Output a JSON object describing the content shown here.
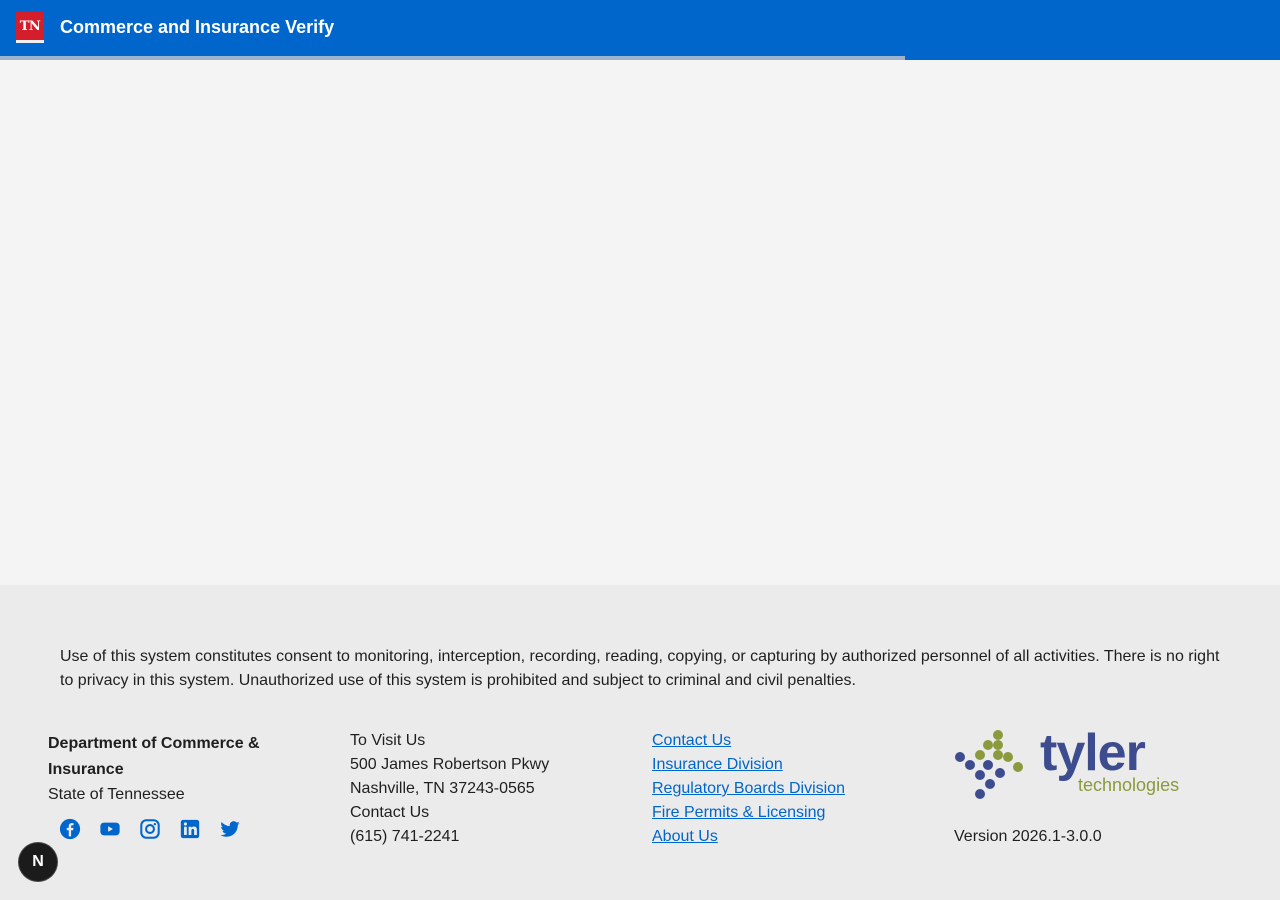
{
  "header": {
    "logo_text": "TN",
    "title": "Commerce and Insurance Verify",
    "progress": 0.707
  },
  "footer": {
    "disclaimer": "Use of this system constitutes consent to monitoring, interception, recording, reading, copying, or capturing by authorized personnel of all activities. There is no right to privacy in this system. Unauthorized use of this system is prohibited and subject to criminal and civil penalties.",
    "department": {
      "name": "Department of Commerce & Insurance",
      "state": "State of Tennessee",
      "social": [
        "facebook-icon",
        "youtube-icon",
        "instagram-icon",
        "linkedin-icon",
        "twitter-icon"
      ]
    },
    "visit": {
      "heading": "To Visit Us",
      "address1": "500 James Robertson Pkwy",
      "address2": "Nashville, TN 37243-0565",
      "contact_heading": "Contact Us",
      "phone": "(615) 741-2241"
    },
    "links": [
      {
        "label": "Contact Us"
      },
      {
        "label": "Insurance Division"
      },
      {
        "label": "Regulatory Boards Division"
      },
      {
        "label": "Fire Permits & Licensing"
      },
      {
        "label": "About Us"
      }
    ],
    "tyler": {
      "word": "tyler",
      "sub": "technologies"
    },
    "version": "Version 2026.1-3.0.0"
  },
  "dev_badge": "N",
  "colors": {
    "brand_blue": "#0066cc",
    "tn_red": "#d41e2b",
    "tyler_blue": "#3d4c8f",
    "tyler_green": "#8a9a3c"
  }
}
